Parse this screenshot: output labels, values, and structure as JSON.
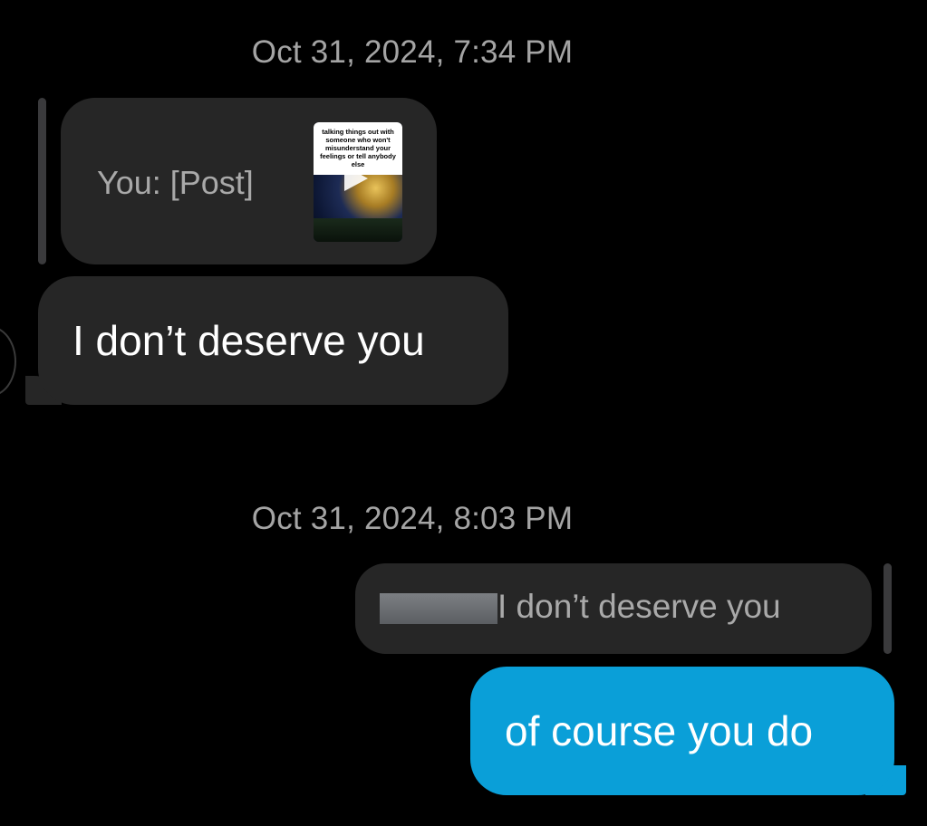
{
  "thread": {
    "timestamps": [
      "Oct 31, 2024, 7:34 PM",
      "Oct 31, 2024, 8:03 PM"
    ],
    "messages": [
      {
        "sender": "other",
        "reply_to": {
          "label": "You: [Post]",
          "post_thumbnail": {
            "caption": "talking things out with someone who won't misunderstand your feelings or tell anybody else",
            "icon": "play-icon"
          }
        },
        "text": "I don’t deserve you"
      },
      {
        "sender": "me",
        "reply_to": {
          "label": "I don’t deserve you",
          "name_redacted": true
        },
        "text": "of course you do"
      }
    ]
  },
  "colors": {
    "background": "#000000",
    "received_bubble": "#262626",
    "sent_bubble": "#0a9fd8",
    "timestamp": "#a4a4a4",
    "quoted_text": "#a9a9a9"
  }
}
